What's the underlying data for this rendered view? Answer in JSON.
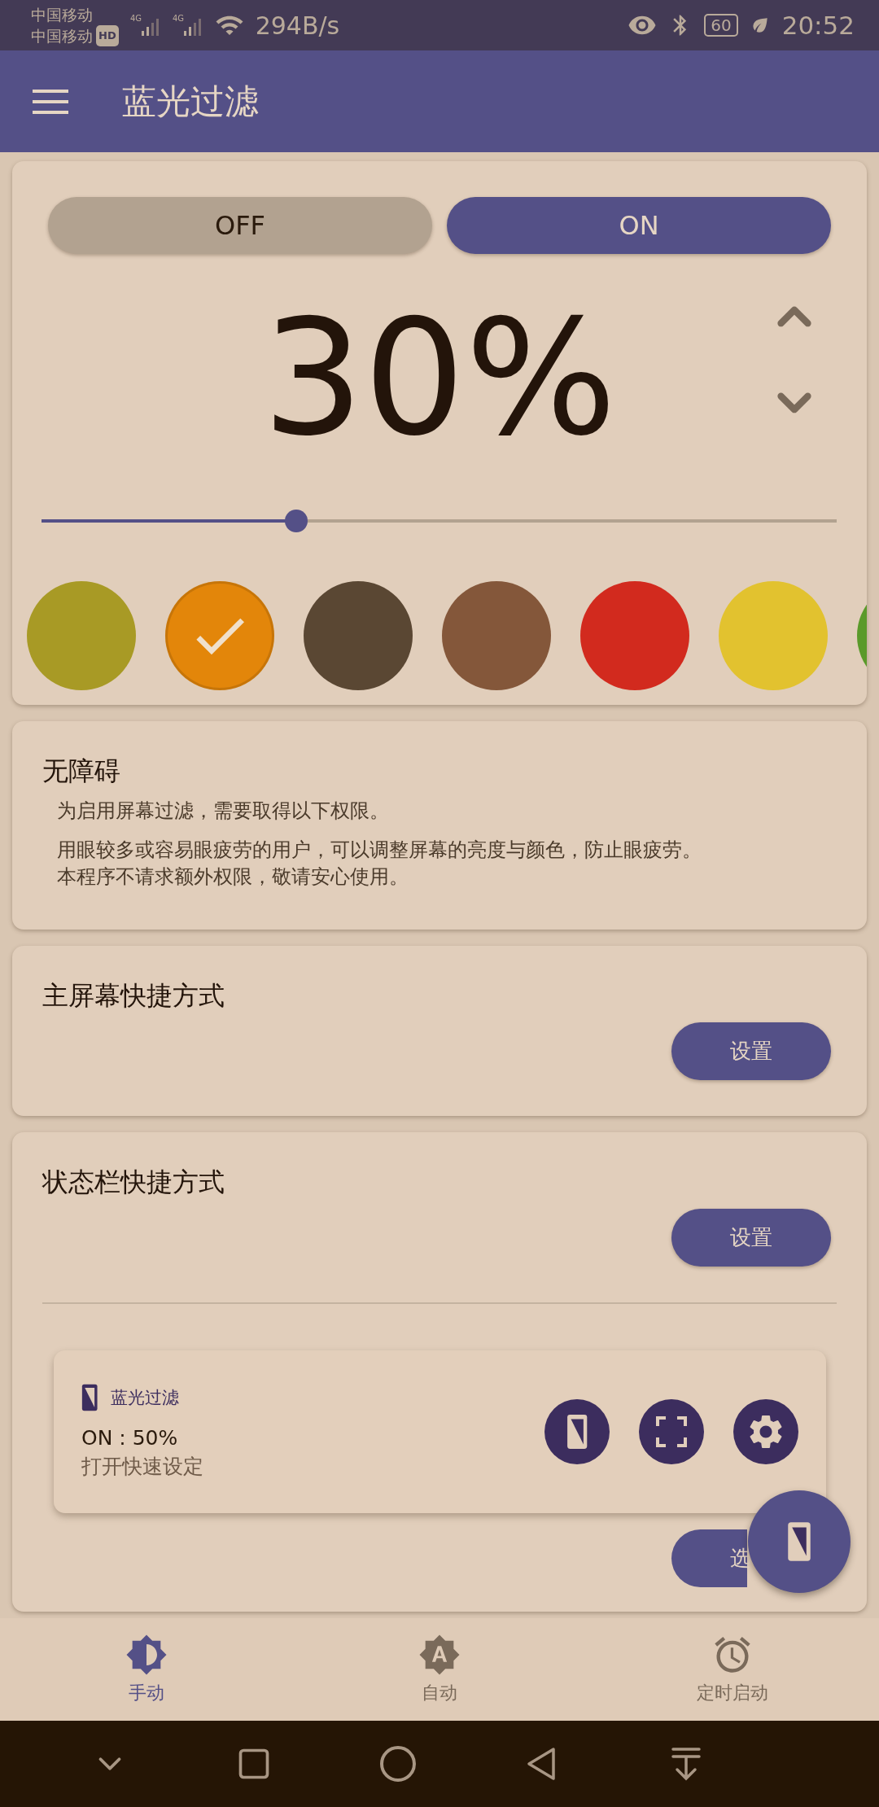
{
  "status_bar": {
    "carriers": [
      "中国移动",
      "中国移动"
    ],
    "hd_badge": "HD",
    "networks": [
      "4G",
      "4G"
    ],
    "speed": "294B/s",
    "battery": "60",
    "time": "20:52"
  },
  "app_bar": {
    "title": "蓝光过滤"
  },
  "filter": {
    "toggle": [
      {
        "label": "OFF",
        "selected": false
      },
      {
        "label": "ON",
        "selected": true
      }
    ],
    "percent": "30%",
    "level": 0.32,
    "colors": [
      {
        "color": "#a89a25",
        "selected": false
      },
      {
        "color": "#e3860a",
        "selected": true
      },
      {
        "color": "#5a4733",
        "selected": false
      },
      {
        "color": "#84573a",
        "selected": false
      },
      {
        "color": "#d22a1e",
        "selected": false
      },
      {
        "color": "#e2c22f",
        "selected": false
      },
      {
        "color": "#5a9a2a",
        "selected": false
      }
    ]
  },
  "accessibility": {
    "title": "无障碍",
    "paragraphs": [
      [
        "为启用屏幕过滤，需要取得以下权限。"
      ],
      [
        "用眼较多或容易眼疲劳的用户，可以调整屏幕的亮度与颜色，防止眼疲劳。",
        "本程序不请求额外权限，敬请安心使用。"
      ]
    ]
  },
  "home_shortcut": {
    "title": "主屏幕快捷方式",
    "button": "设置"
  },
  "statusbar_shortcut": {
    "title": "状态栏快捷方式",
    "button": "设置",
    "notification": {
      "app": "蓝光过滤",
      "status": "ON : 50%",
      "subtitle": "打开快速设定"
    },
    "options_button": "选"
  },
  "bottom_nav": [
    {
      "label": "手动",
      "selected": true
    },
    {
      "label": "自动",
      "selected": false
    },
    {
      "label": "定时启动",
      "selected": false
    }
  ]
}
